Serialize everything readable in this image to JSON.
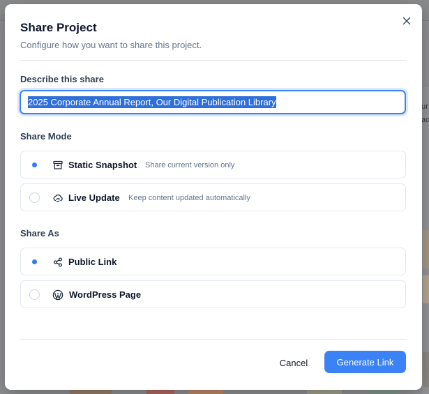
{
  "background": {
    "right_text_1": "ur",
    "right_text_2": "ac"
  },
  "modal": {
    "title": "Share Project",
    "subtitle": "Configure how you want to share this project.",
    "close_icon": "close-icon"
  },
  "describe": {
    "label": "Describe this share",
    "value": "2025 Corporate Annual Report, Our Digital Publication Library"
  },
  "share_mode": {
    "label": "Share Mode",
    "options": [
      {
        "label": "Static Snapshot",
        "description": "Share current version only",
        "icon": "archive-box-icon",
        "selected": true
      },
      {
        "label": "Live Update",
        "description": "Keep content updated automatically",
        "icon": "refresh-cloud-icon",
        "selected": false
      }
    ]
  },
  "share_as": {
    "label": "Share As",
    "options": [
      {
        "label": "Public Link",
        "icon": "share-nodes-icon",
        "selected": true
      },
      {
        "label": "WordPress Page",
        "icon": "wordpress-icon",
        "selected": false
      }
    ]
  },
  "footer": {
    "cancel_label": "Cancel",
    "primary_label": "Generate Link"
  },
  "colors": {
    "accent": "#3b82f6",
    "selection": "#2f6fdb",
    "radio_selected": "#2f7cf6"
  }
}
